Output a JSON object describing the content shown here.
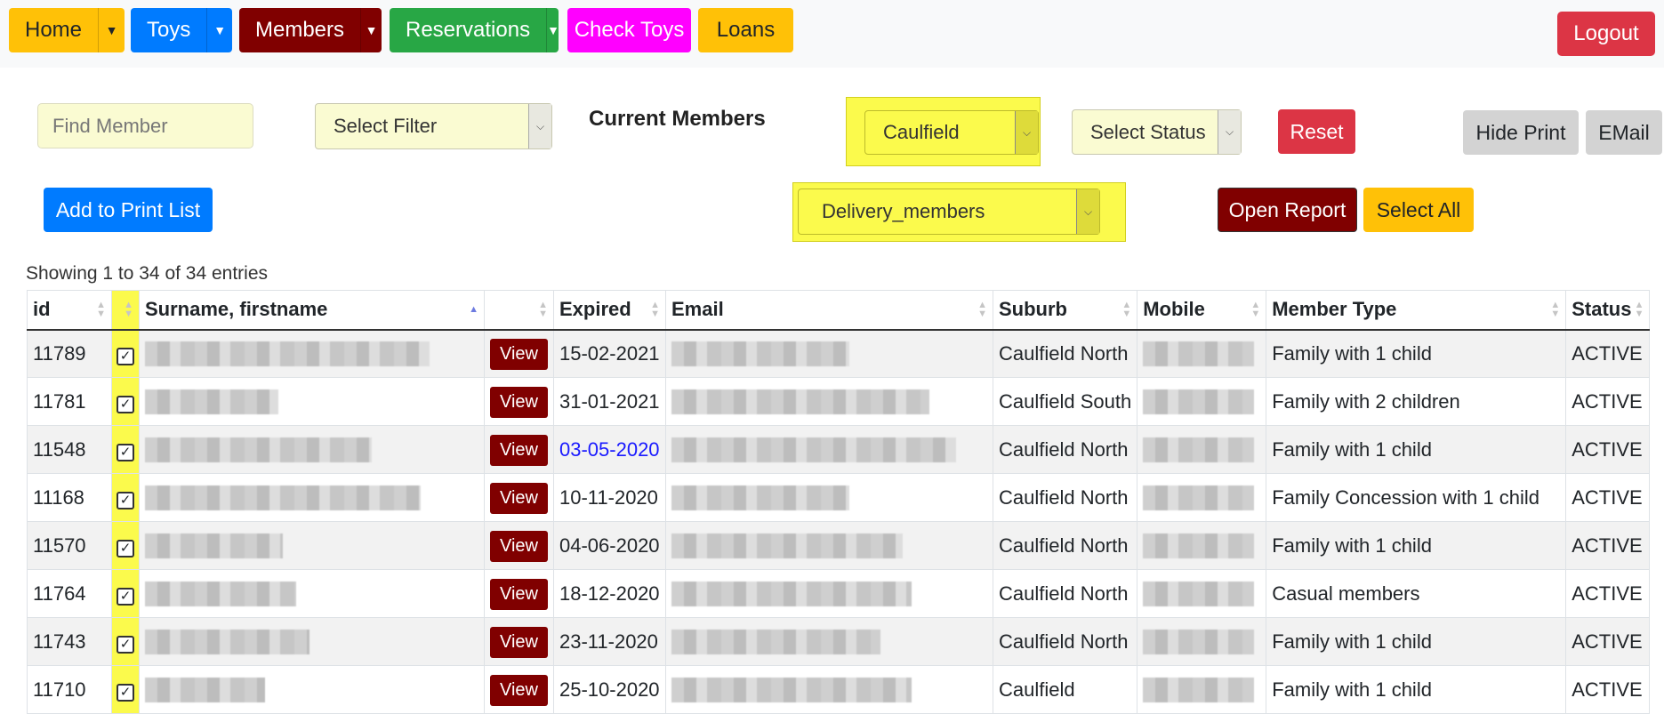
{
  "nav": {
    "items": [
      {
        "label": "Home",
        "dropdown": true,
        "bg": "#ffc107",
        "fg": "#212529"
      },
      {
        "label": "Toys",
        "dropdown": true,
        "bg": "#007bff",
        "fg": "#ffffff"
      },
      {
        "label": "Members",
        "dropdown": true,
        "bg": "#800000",
        "fg": "#ffffff"
      },
      {
        "label": "Reservations",
        "dropdown": true,
        "bg": "#28a745",
        "fg": "#ffffff"
      },
      {
        "label": "Check Toys",
        "dropdown": false,
        "bg": "#ff00ff",
        "fg": "#ffffff"
      },
      {
        "label": "Loans",
        "dropdown": false,
        "bg": "#ffc107",
        "fg": "#212529"
      }
    ],
    "logout_label": "Logout"
  },
  "filters": {
    "find_placeholder": "Find Member",
    "select_filter": "Select Filter",
    "page_title": "Current Members",
    "suburb_value": "Caulfield",
    "status_value": "Select Status",
    "member_group_value": "Delivery_members",
    "reset_label": "Reset",
    "hide_print_label": "Hide Print",
    "email_label": "EMail",
    "add_print_label": "Add to Print List",
    "open_report_label": "Open Report",
    "select_all_label": "Select All"
  },
  "table": {
    "showing_text": "Showing 1 to 34 of 34 entries",
    "headers": [
      "id",
      "",
      "Surname, firstname",
      "",
      "Expired",
      "Email",
      "Suburb",
      "Mobile",
      "Member Type",
      "Status"
    ],
    "view_label": "View",
    "rows": [
      {
        "id": "11789",
        "checked": true,
        "expired": "15-02-2021",
        "expired_highlight": false,
        "suburb": "Caulfield North",
        "member_type": "Family with 1 child",
        "status": "ACTIVE"
      },
      {
        "id": "11781",
        "checked": true,
        "expired": "31-01-2021",
        "expired_highlight": false,
        "suburb": "Caulfield South",
        "member_type": "Family with 2 children",
        "status": "ACTIVE"
      },
      {
        "id": "11548",
        "checked": true,
        "expired": "03-05-2020",
        "expired_highlight": true,
        "suburb": "Caulfield North",
        "member_type": "Family with 1 child",
        "status": "ACTIVE"
      },
      {
        "id": "11168",
        "checked": true,
        "expired": "10-11-2020",
        "expired_highlight": false,
        "suburb": "Caulfield North",
        "member_type": "Family Concession with 1 child",
        "status": "ACTIVE"
      },
      {
        "id": "11570",
        "checked": true,
        "expired": "04-06-2020",
        "expired_highlight": false,
        "suburb": "Caulfield North",
        "member_type": "Family with 1 child",
        "status": "ACTIVE"
      },
      {
        "id": "11764",
        "checked": true,
        "expired": "18-12-2020",
        "expired_highlight": false,
        "suburb": "Caulfield North",
        "member_type": "Casual members",
        "status": "ACTIVE"
      },
      {
        "id": "11743",
        "checked": true,
        "expired": "23-11-2020",
        "expired_highlight": false,
        "suburb": "Caulfield North",
        "member_type": "Family with 1 child",
        "status": "ACTIVE"
      },
      {
        "id": "11710",
        "checked": true,
        "expired": "25-10-2020",
        "expired_highlight": false,
        "suburb": "Caulfield",
        "member_type": "Family with 1 child",
        "status": "ACTIVE"
      }
    ]
  },
  "colors": {
    "highlight_yellow": "#fbfa4c",
    "input_bg": "#fafbd2",
    "reset_red": "#dc3545",
    "report_maroon": "#800000",
    "select_all_amber": "#ffc107",
    "add_print_blue": "#007bff",
    "grey_button": "#d3d3d3",
    "expired_blue": "#1a1aff"
  },
  "icons": {
    "dropdown": "caret-down-icon",
    "select_arrow": "chevron-down-icon",
    "sort": "sort-arrows-icon",
    "checkbox": "checkmark-icon"
  }
}
